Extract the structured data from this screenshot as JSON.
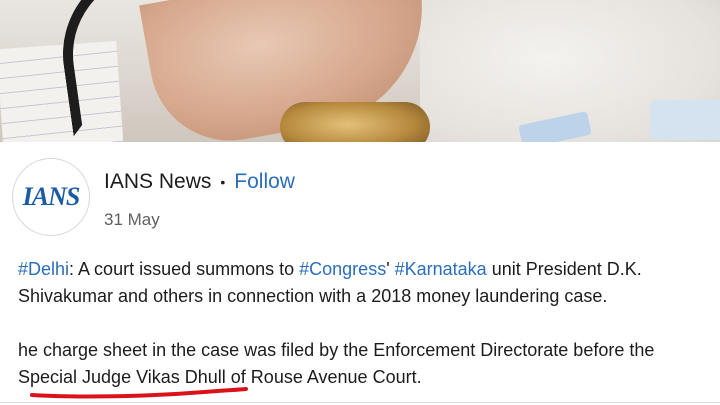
{
  "post": {
    "author": {
      "logo_text": "IANS",
      "name": "IANS News",
      "separator": "•",
      "follow_label": "Follow"
    },
    "date": "31 May",
    "paragraph1": {
      "tag_delhi": "#Delhi",
      "text_a": ": A court issued summons to ",
      "tag_congress": "#Congress",
      "text_b": "' ",
      "tag_karnataka": "#Karnataka",
      "text_c": " unit President D.K. Shivakumar and others in connection with a 2018 money laundering case."
    },
    "paragraph2": {
      "line1": "he charge sheet in the case was filed by the Enforcement Directorate before the",
      "line2": "Special Judge Vikas Dhull of Rouse Avenue Court."
    }
  },
  "colors": {
    "link": "#2a6ebb",
    "logo_blue": "#1a5aa6",
    "annotation_red": "#d8141a"
  }
}
